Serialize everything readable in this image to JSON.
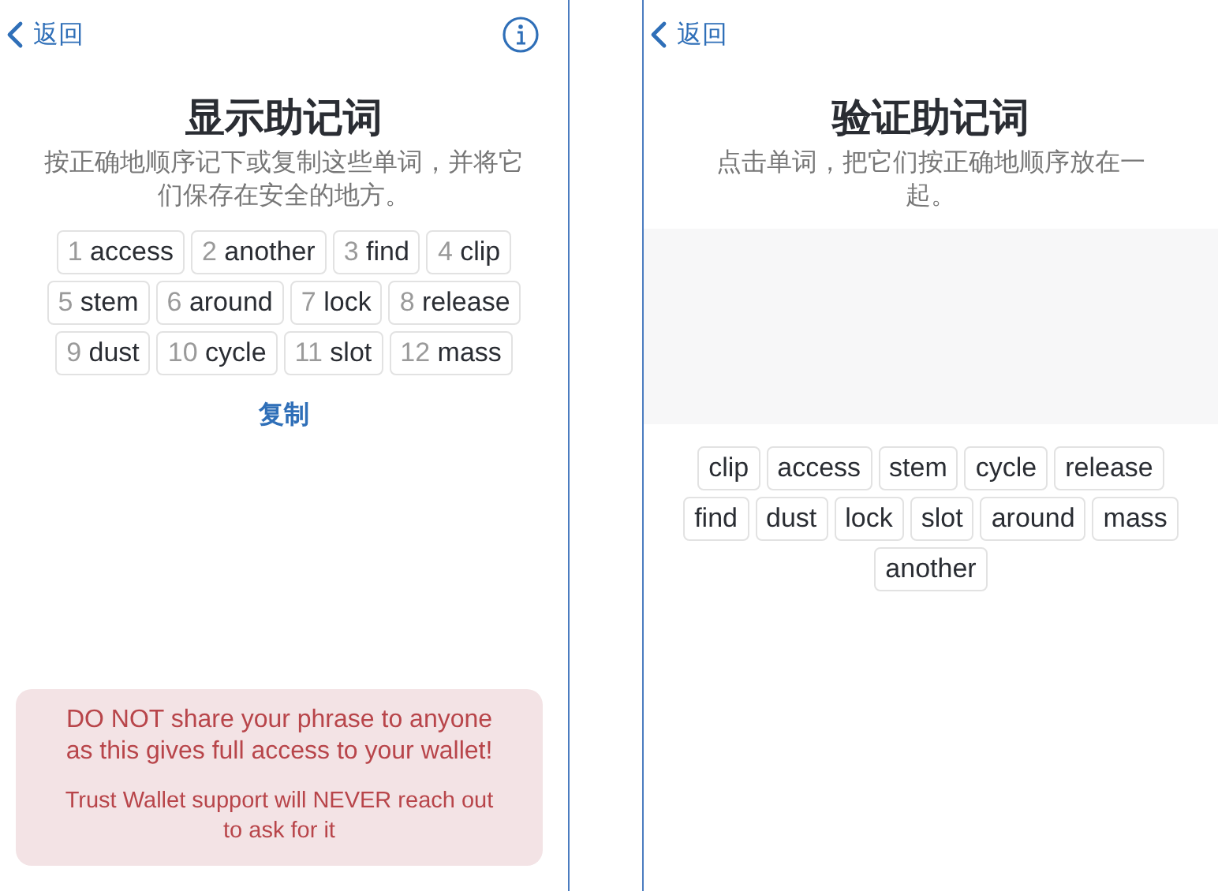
{
  "screens": [
    {
      "back": "返回",
      "info_button": true,
      "title": "显示助记词",
      "subtitle": "按正确地顺序记下或复制这些单词，并将它们保存在安全的地方。",
      "words": [
        {
          "number": "1",
          "word": "access"
        },
        {
          "number": "2",
          "word": "another"
        },
        {
          "number": "3",
          "word": "find"
        },
        {
          "number": "4",
          "word": "clip"
        },
        {
          "number": "5",
          "word": "stem"
        },
        {
          "number": "6",
          "word": "around"
        },
        {
          "number": "7",
          "word": "lock"
        },
        {
          "number": "8",
          "word": "release"
        },
        {
          "number": "9",
          "word": "dust"
        },
        {
          "number": "10",
          "word": "cycle"
        },
        {
          "number": "11",
          "word": "slot"
        },
        {
          "number": "12",
          "word": "mass"
        }
      ],
      "copy_button": "复制",
      "warning": {
        "main": "DO NOT share your phrase to anyone as this gives full access to your wallet!",
        "note": "Trust Wallet support will NEVER reach out to ask for it"
      }
    },
    {
      "back": "返回",
      "title": "验证助记词",
      "subtitle": "点击单词，把它们按正确地顺序放在一起。",
      "choices": [
        "clip",
        "access",
        "stem",
        "cycle",
        "release",
        "find",
        "dust",
        "lock",
        "slot",
        "around",
        "mass",
        "another"
      ]
    }
  ]
}
